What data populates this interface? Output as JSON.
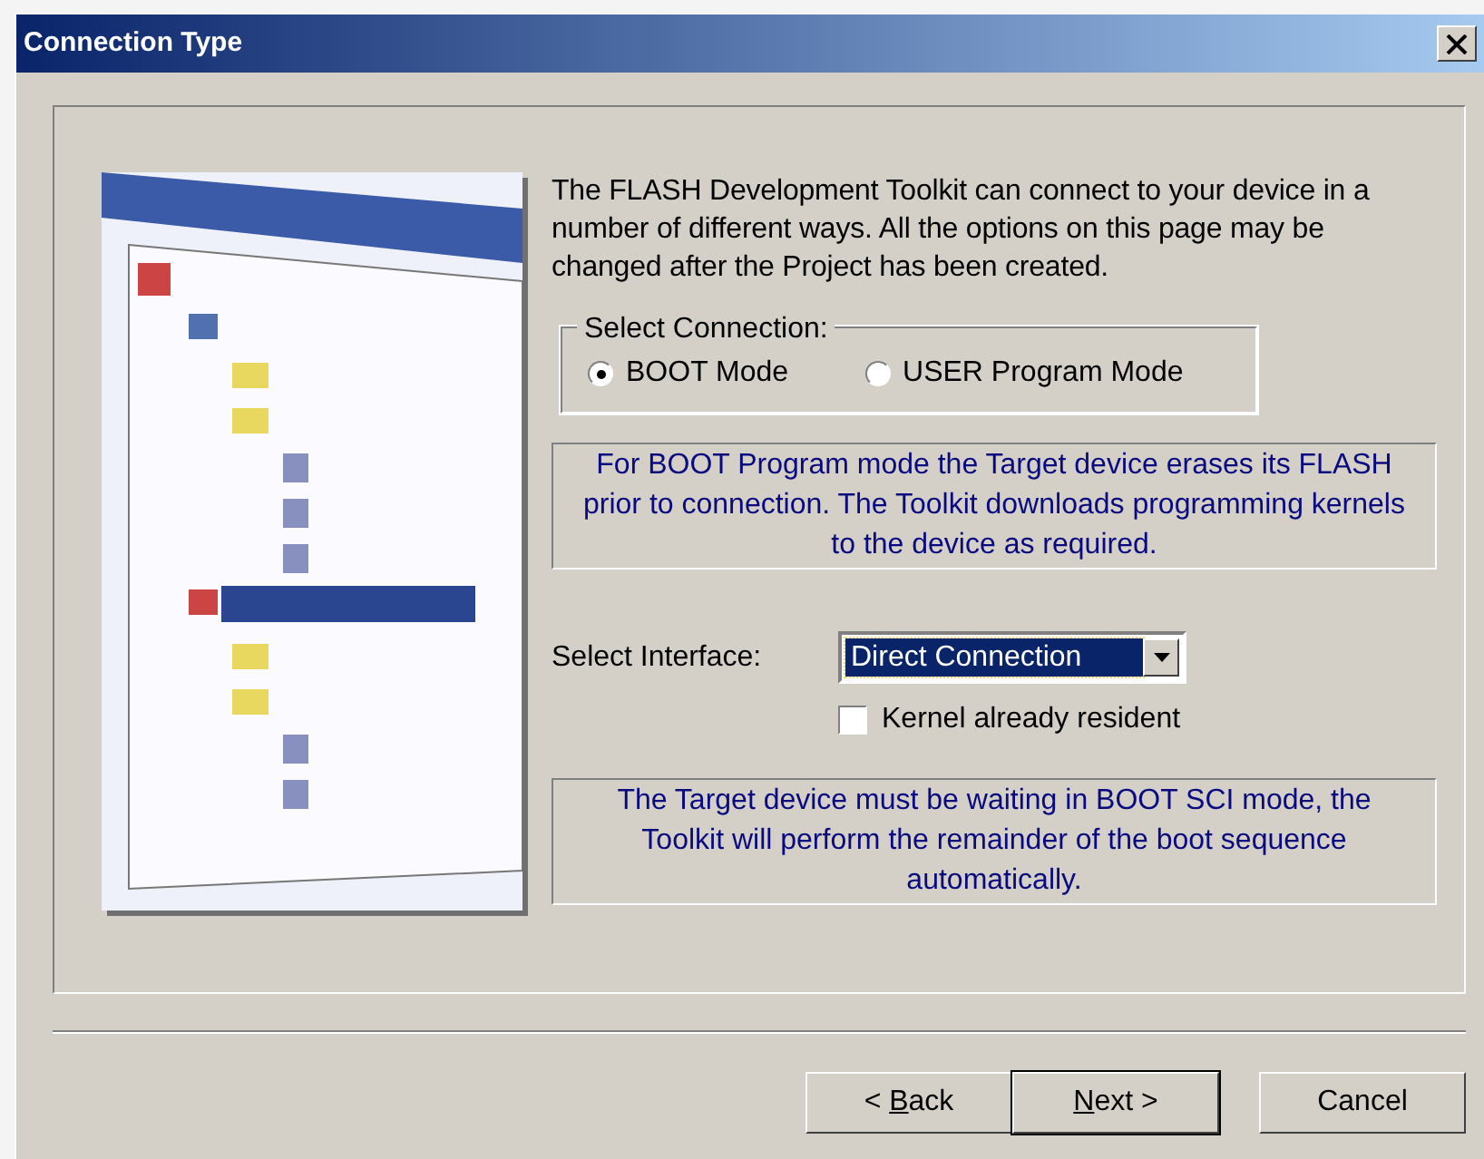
{
  "window": {
    "title": "Connection Type"
  },
  "intro": "The FLASH Development Toolkit can connect to your device in a number of different ways. All the options on this page may be changed after the Project has been created.",
  "connection": {
    "legend": "Select Connection:",
    "options": [
      {
        "label": "BOOT Mode",
        "selected": true
      },
      {
        "label": "USER Program Mode",
        "selected": false
      }
    ]
  },
  "connection_info": "For BOOT Program mode the Target device erases its FLASH prior to connection. The Toolkit downloads programming kernels to the device as required.",
  "interface": {
    "label": "Select Interface:",
    "value": "Direct Connection"
  },
  "kernel_resident": {
    "label": "Kernel already resident",
    "checked": false
  },
  "interface_info": "The Target device must be waiting in BOOT SCI mode, the Toolkit will perform the remainder of the boot sequence automatically.",
  "buttons": [
    {
      "parts": [
        {
          "text": "< ",
          "underlined": false
        },
        {
          "text": "B",
          "underlined": true
        },
        {
          "text": "ack",
          "underlined": false
        }
      ],
      "default": false
    },
    {
      "parts": [
        {
          "text": "N",
          "underlined": true
        },
        {
          "text": "ext >",
          "underlined": false
        }
      ],
      "default": true
    },
    {
      "parts": [
        {
          "text": "Cancel",
          "underlined": false
        }
      ],
      "default": false
    }
  ]
}
